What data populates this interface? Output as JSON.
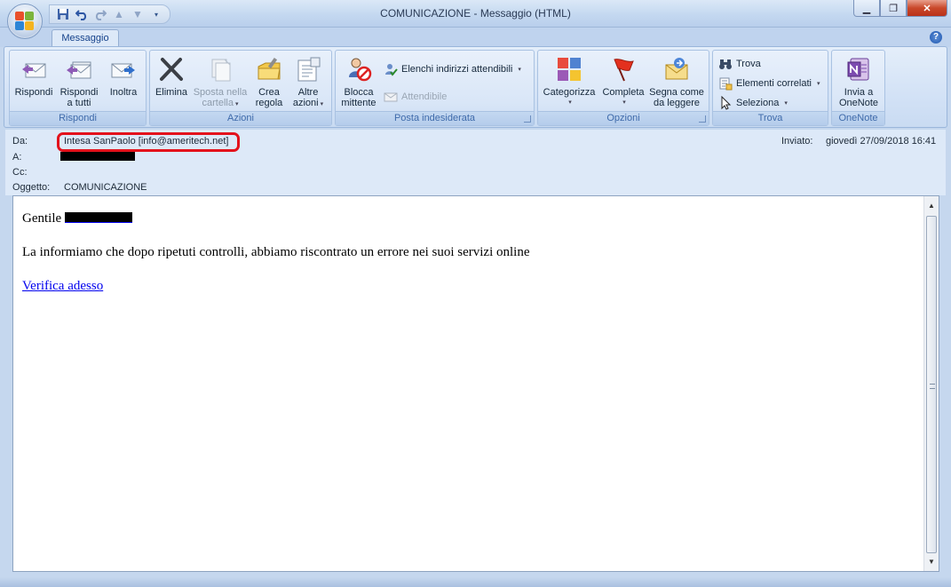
{
  "window": {
    "title": "COMUNICAZIONE - Messaggio (HTML)",
    "min_icon": "minimize-icon",
    "max_icon": "maximize-icon",
    "close_icon": "close-icon"
  },
  "ribbon": {
    "active_tab": "Messaggio",
    "groups": {
      "rispondi": {
        "label": "Rispondi",
        "reply": [
          "Rispondi",
          ""
        ],
        "reply_all": [
          "Rispondi",
          "a tutti"
        ],
        "forward": [
          "Inoltra",
          ""
        ]
      },
      "azioni": {
        "label": "Azioni",
        "delete": [
          "Elimina",
          ""
        ],
        "move": [
          "Sposta nella",
          "cartella"
        ],
        "rule": [
          "Crea",
          "regola"
        ],
        "other": [
          "Altre",
          "azioni"
        ]
      },
      "posta": {
        "label": "Posta indesiderata",
        "block": [
          "Blocca",
          "mittente"
        ],
        "safe_lists": "Elenchi indirizzi attendibili",
        "trusted": "Attendibile"
      },
      "opzioni": {
        "label": "Opzioni",
        "categorize": [
          "Categorizza",
          ""
        ],
        "followup": [
          "Completa",
          ""
        ],
        "mark_read": [
          "Segna come",
          "da leggere"
        ]
      },
      "trova": {
        "label": "Trova",
        "find": "Trova",
        "related": "Elementi correlati",
        "select": "Seleziona"
      },
      "onenote": {
        "label": "OneNote",
        "send": [
          "Invia a",
          "OneNote"
        ]
      }
    },
    "colors": {
      "accent": "#15428b",
      "group_label": "#3e6aaa"
    }
  },
  "header": {
    "from_label": "Da:",
    "from_value": "Intesa SanPaolo [info@ameritech.net]",
    "to_label": "A:",
    "cc_label": "Cc:",
    "subject_label": "Oggetto:",
    "subject_value": "COMUNICAZIONE",
    "sent_label": "Inviato:",
    "sent_value": "giovedì 27/09/2018 16:41",
    "highlight_color": "#e3121c"
  },
  "message": {
    "greeting": "Gentile",
    "line1": "La informiamo che dopo ripetuti controlli, abbiamo riscontrato un errore nei suoi servizi online",
    "link": "Verifica adesso"
  }
}
